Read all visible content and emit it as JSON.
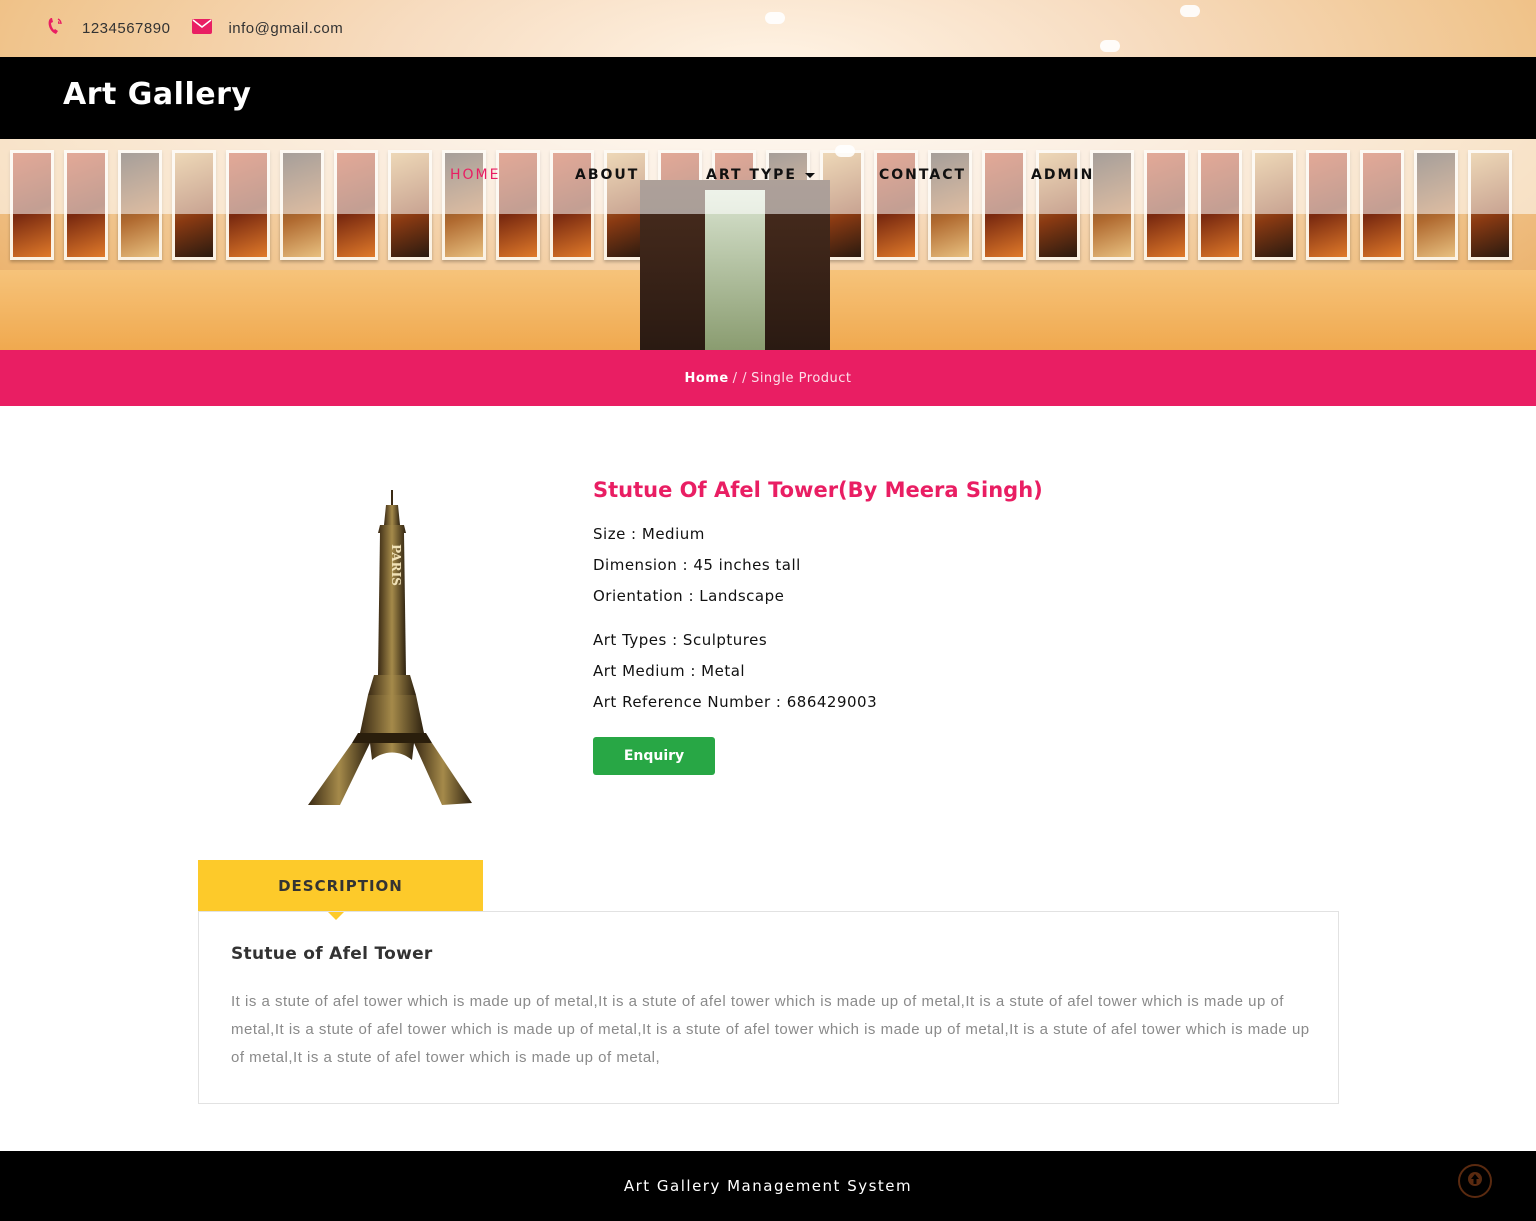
{
  "topbar": {
    "phone": "1234567890",
    "email": "info@gmail.com",
    "phone_icon": "phone-icon",
    "email_icon": "envelope-icon"
  },
  "brand": "Art Gallery",
  "nav": {
    "home": "HOME",
    "about": "ABOUT",
    "art_type": "ART TYPE",
    "contact": "CONTACT",
    "admin": "ADMIN"
  },
  "breadcrumb": {
    "home": "Home",
    "separator": "/ /",
    "current": "Single Product"
  },
  "product": {
    "title": "Stutue Of Afel Tower(By Meera Singh)",
    "size": "Size : Medium",
    "dimension": "Dimension : 45 inches tall",
    "orientation": "Orientation : Landscape",
    "art_types": "Art Types : Sculptures",
    "art_medium": "Art Medium : Metal",
    "reference": "Art Reference Number : 686429003",
    "enquiry_label": "Enquiry",
    "image_text": "PARIS"
  },
  "tabs": {
    "description": "DESCRIPTION"
  },
  "description": {
    "title": "Stutue of Afel Tower",
    "text": "It is a stute of afel tower which is made up of metal,It is a stute of afel tower which is made up of metal,It is a stute of afel tower which is made up of metal,It is a stute of afel tower which is made up of metal,It is a stute of afel tower which is made up of metal,It is a stute of afel tower which is made up of metal,It is a stute of afel tower which is made up of metal,"
  },
  "footer": {
    "text": "Art Gallery Management System",
    "to_top_icon": "arrow-up-icon"
  },
  "colors": {
    "accent": "#e91e63",
    "enquiry_button": "#28a745",
    "tab": "#fdca2a",
    "header": "#000000"
  }
}
